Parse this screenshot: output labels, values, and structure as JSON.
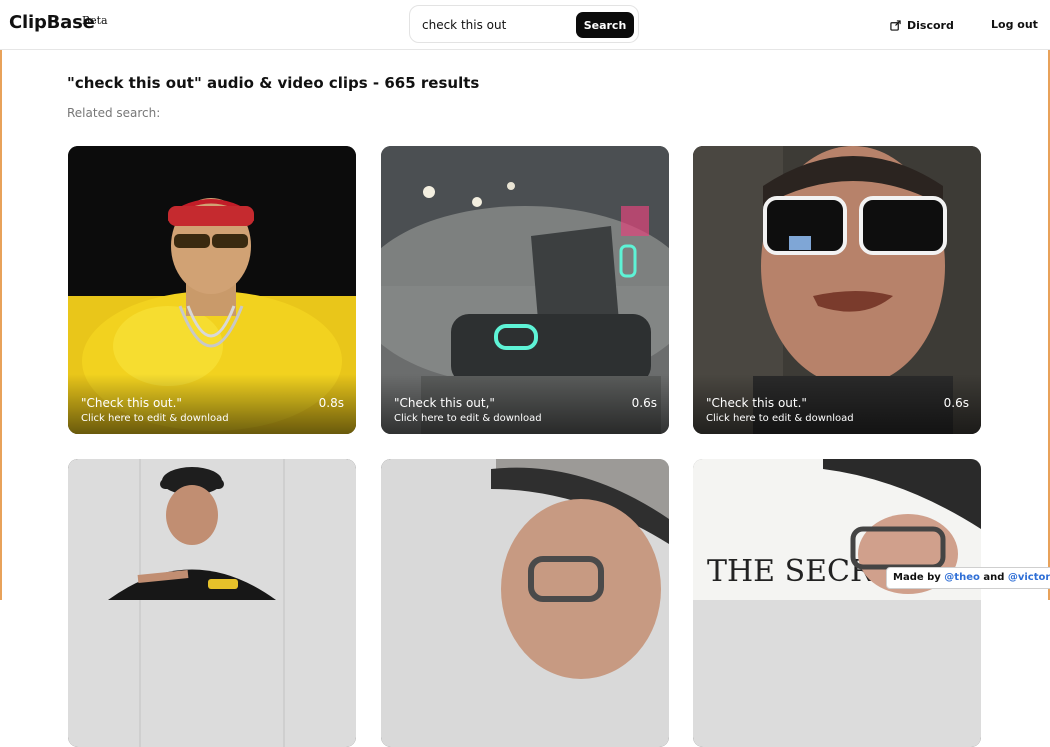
{
  "header": {
    "logo": "ClipBase",
    "badge": "Beta",
    "search_value": "check this out",
    "search_button": "Search",
    "discord_label": "Discord",
    "logout_label": "Log out"
  },
  "main": {
    "results_title": "\"check this out\" audio & video clips - 665 results",
    "related_label": "Related search:"
  },
  "clips": [
    {
      "quote": "\"Check this out.\"",
      "cta": "Click here to edit & download",
      "duration": "0.8s"
    },
    {
      "quote": "\"Check this out,\"",
      "cta": "Click here to edit & download",
      "duration": "0.6s"
    },
    {
      "quote": "\"Check this out.\"",
      "cta": "Click here to edit & download",
      "duration": "0.6s"
    }
  ],
  "footer_badge": {
    "made_by": "Made by",
    "author1": "@theo",
    "and": "and",
    "author2": "@victor"
  },
  "colors": {
    "accent_edge": "#e8a25a",
    "search_button_bg": "#0b0b0b",
    "link_blue": "#2f6fd6"
  },
  "icons": {
    "discord": "external-link-icon"
  }
}
